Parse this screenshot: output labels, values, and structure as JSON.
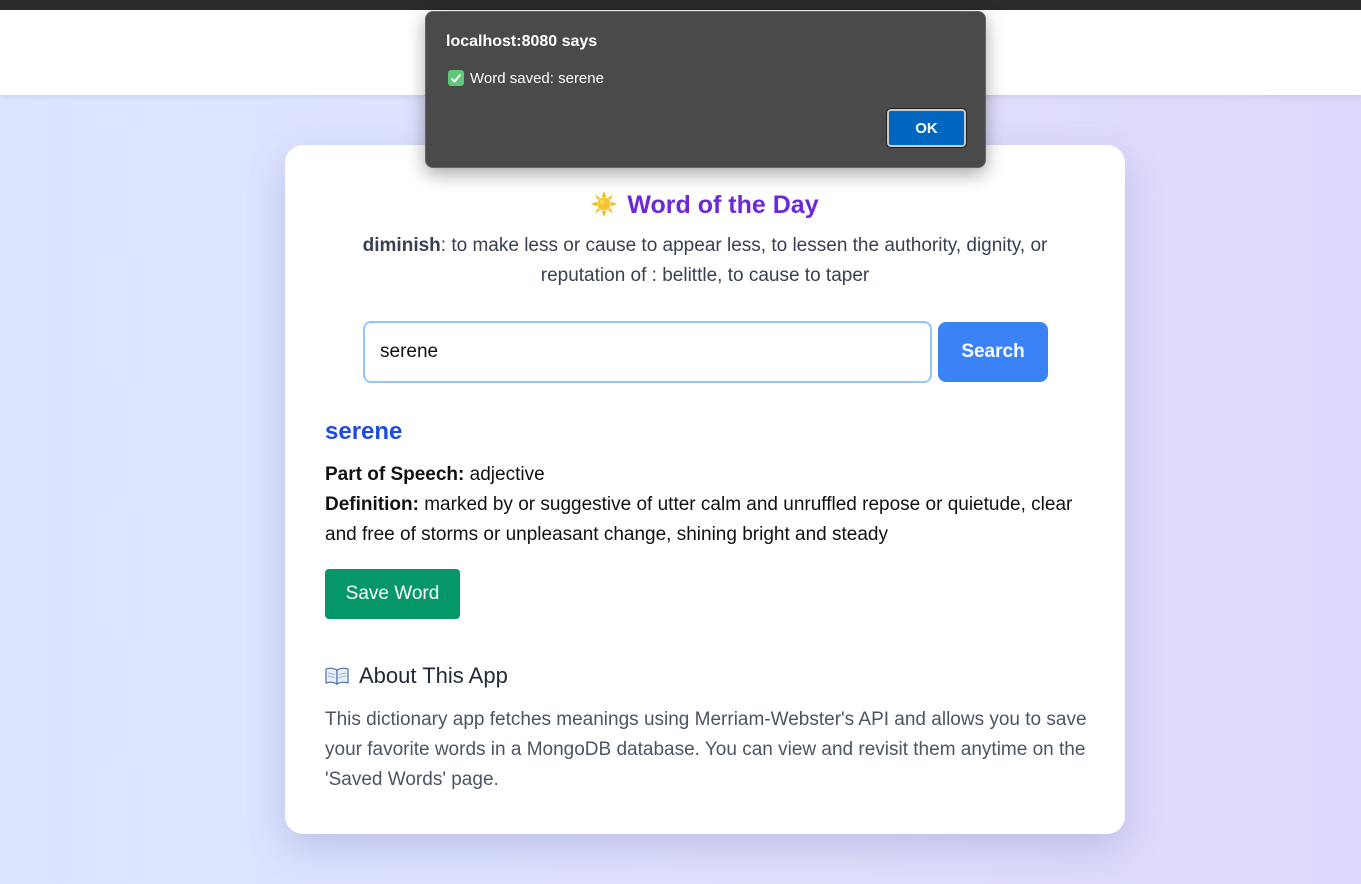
{
  "word_of_day": {
    "title": "Word of the Day",
    "icon": "sun-icon",
    "word": "diminish",
    "definition": ": to make less or cause to appear less, to lessen the authority, dignity, or reputation of : belittle, to cause to taper"
  },
  "search": {
    "value": "serene",
    "button_label": "Search"
  },
  "result": {
    "word": "serene",
    "pos_label": "Part of Speech:",
    "pos_value": "adjective",
    "def_label": "Definition:",
    "def_value": "marked by or suggestive of utter calm and unruffled repose or quietude, clear and free of storms or unpleasant change, shining bright and steady",
    "save_label": "Save Word"
  },
  "about": {
    "icon": "book-icon",
    "title": "About This App",
    "text": "This dictionary app fetches meanings using Merriam-Webster's API and allows you to save your favorite words in a MongoDB database. You can view and revisit them anytime on the 'Saved Words' page."
  },
  "dialog": {
    "title": "localhost:8080 says",
    "icon": "check-icon",
    "message": "Word saved: serene",
    "ok_label": "OK"
  },
  "colors": {
    "accent_purple": "#6d28d9",
    "link_blue": "#1d4ed8",
    "search_blue": "#3b82f6",
    "save_green": "#059669",
    "dialog_bg": "#4a4a4a",
    "ok_blue": "#0067c0"
  }
}
